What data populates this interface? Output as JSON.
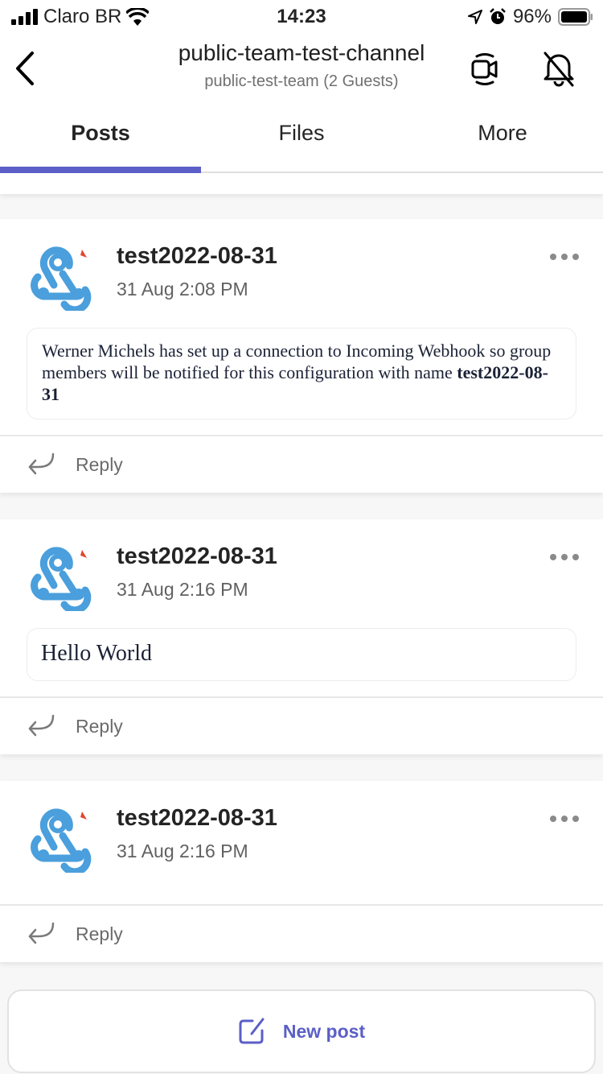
{
  "status_bar": {
    "carrier": "Claro BR",
    "time": "14:23",
    "battery": "96%",
    "icons": [
      "signal-icon",
      "wifi-icon",
      "location-icon",
      "alarm-icon",
      "battery-icon"
    ]
  },
  "header": {
    "title": "public-team-test-channel",
    "subtitle": "public-test-team (2 Guests)",
    "icons": [
      "back-icon",
      "video-call-icon",
      "notifications-off-icon"
    ]
  },
  "tabs": [
    {
      "label": "Posts",
      "active": true
    },
    {
      "label": "Files",
      "active": false
    },
    {
      "label": "More",
      "active": false
    }
  ],
  "posts": [
    {
      "author": "test2022-08-31",
      "time": "31 Aug 2:08 PM",
      "message_text": "Werner Michels has set up a connection to Incoming Webhook so group members will be notified for this configuration with name ",
      "message_bold": "test2022-08-31",
      "reply_label": "Reply"
    },
    {
      "author": "test2022-08-31",
      "time": "31 Aug 2:16 PM",
      "message_text": "Hello World",
      "reply_label": "Reply"
    },
    {
      "author": "test2022-08-31",
      "time": "31 Aug 2:16 PM",
      "reply_label": "Reply"
    }
  ],
  "new_post": {
    "label": "New post"
  },
  "colors": {
    "accent": "#5b5fc7",
    "webhook_blue": "#4a9fdc",
    "webhook_red": "#e2462f"
  }
}
